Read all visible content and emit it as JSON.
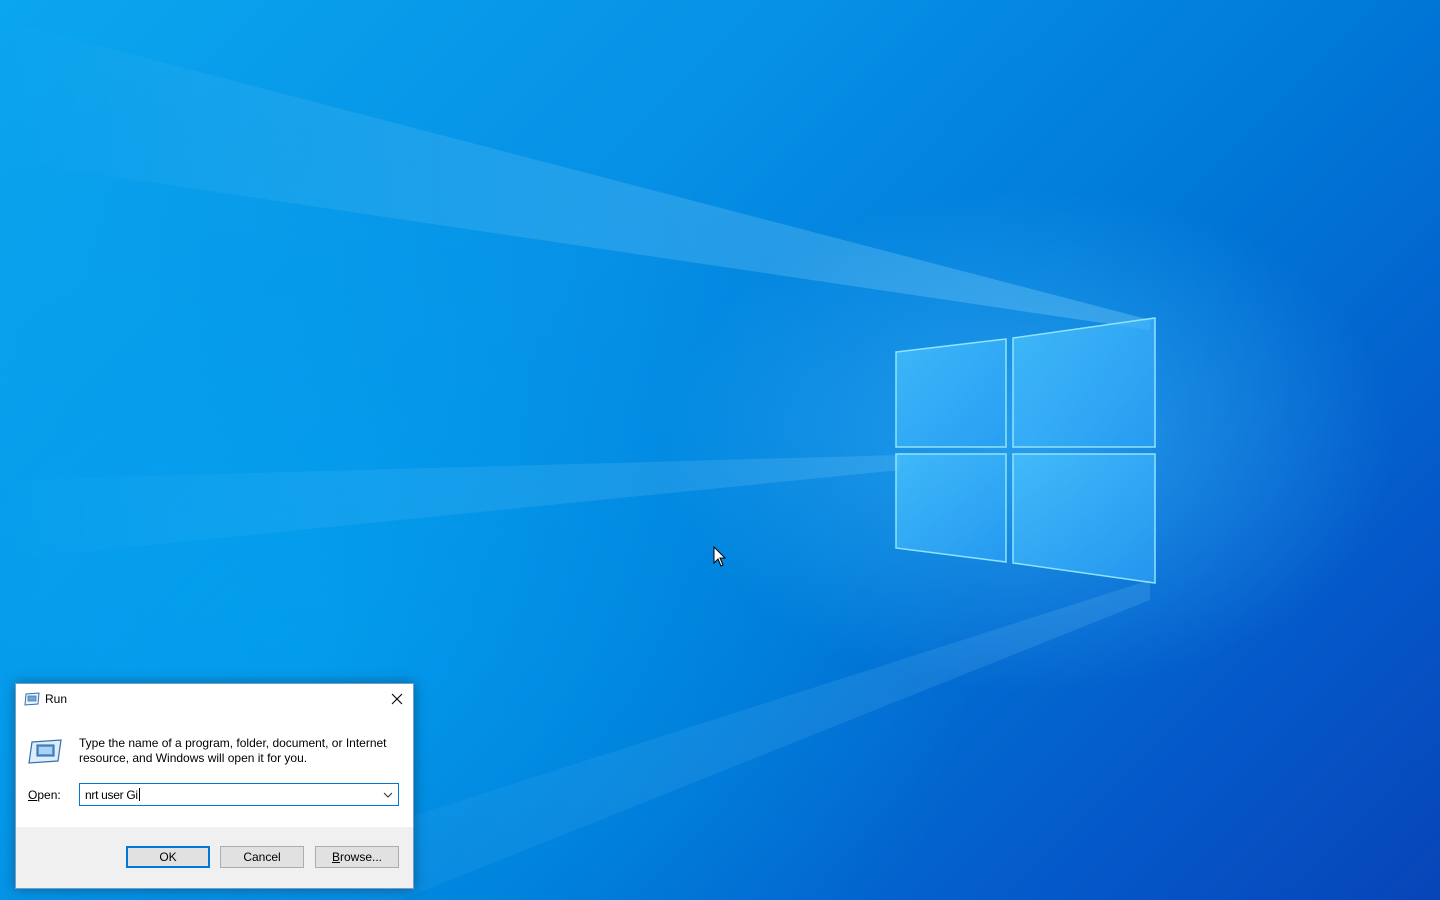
{
  "desktop": {
    "wallpaper": "windows-10-hero-wallpaper",
    "colors": {
      "accent": "#0078d7",
      "deep_blue": "#0745b8",
      "light_blue": "#0aa6ee"
    }
  },
  "run_dialog": {
    "title": "Run",
    "title_icon": "run-icon",
    "close_icon": "close-icon",
    "description": "Type the name of a program, folder, document, or Internet resource, and Windows will open it for you.",
    "open_label_accel": "O",
    "open_label_rest": "pen:",
    "open_value": "nrt user Gi",
    "dropdown_icon": "chevron-down-icon",
    "buttons": {
      "ok": "OK",
      "cancel": "Cancel",
      "browse_accel": "B",
      "browse_rest": "rowse..."
    }
  },
  "cursor": {
    "icon": "mouse-pointer-icon"
  }
}
